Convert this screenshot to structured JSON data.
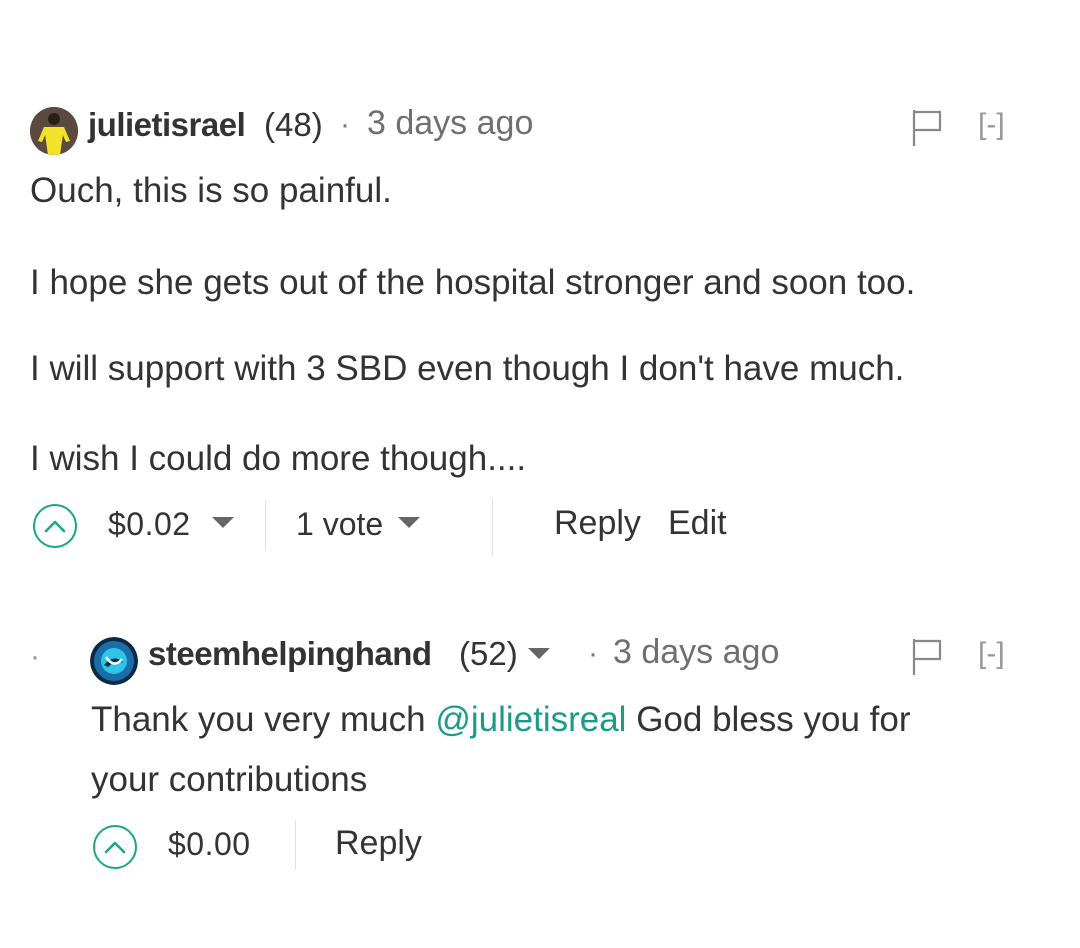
{
  "comments": [
    {
      "author": "julietisrael",
      "reputation": "(48)",
      "separator": "·",
      "time": "3 days ago",
      "collapse_label": "[-]",
      "paragraphs": [
        "Ouch, this is so painful.",
        "I hope she gets out of the hospital stronger and soon too.",
        "I will support with 3 SBD even though I don't have much.",
        "I wish I could do more though...."
      ],
      "payout": "$0.02",
      "votes": "1 vote",
      "reply_label": "Reply",
      "edit_label": "Edit"
    },
    {
      "author": "steemhelpinghand",
      "reputation": "(52)",
      "separator": "·",
      "time": "3 days ago",
      "collapse_label": "[-]",
      "text_before": "Thank you very much ",
      "mention": "@julietisreal",
      "text_after_line1": " God bless you for",
      "text_line2": "your contributions",
      "payout": "$0.00",
      "reply_label": "Reply"
    }
  ],
  "bullet": "·",
  "icons": {
    "flag": "flag-icon",
    "upvote": "chevron-up-icon",
    "dropdown": "caret-down-icon"
  },
  "colors": {
    "accent": "#1aa687",
    "link": "#1a9b8a",
    "text": "#333333",
    "muted": "#6f6f6f"
  }
}
